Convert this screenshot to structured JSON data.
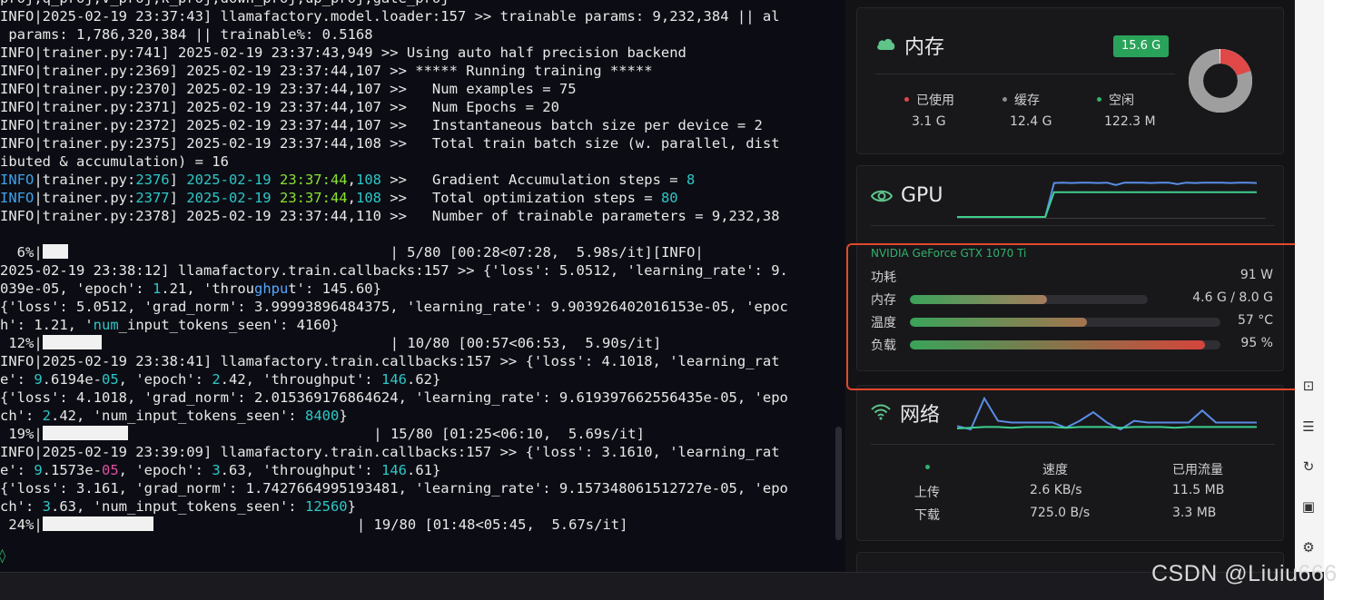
{
  "terminal": {
    "lines": [
      [
        {
          "t": "proj,q_proj,v_proj,k_proj,down_proj,up_proj,gate_proj"
        }
      ],
      [
        {
          "t": "INFO|2025-02-19 23:37:43] llamafactory.model.loader:157 >> trainable params: 9,232,384 || al"
        }
      ],
      [
        {
          "t": " params: 1,786,320,384 || trainable%: 0.5168"
        }
      ],
      [
        {
          "t": "INFO|trainer.py:741] 2025-02-19 23:37:43,949 >> Using auto half precision backend"
        }
      ],
      [
        {
          "t": "INFO|trainer.py:2369] 2025-02-19 23:37:44,107 >> ***** Running training *****"
        }
      ],
      [
        {
          "t": "INFO|trainer.py:2370] 2025-02-19 23:37:44,107 >>   Num examples = 75"
        }
      ],
      [
        {
          "t": "INFO|trainer.py:2371] 2025-02-19 23:37:44,107 >>   Num Epochs = 20"
        }
      ],
      [
        {
          "t": "INFO|trainer.py:2372] 2025-02-19 23:37:44,107 >>   Instantaneous batch size per device = 2"
        }
      ],
      [
        {
          "t": "INFO|trainer.py:2375] 2025-02-19 23:37:44,108 >>   Total train batch size (w. parallel, dist"
        }
      ],
      [
        {
          "t": "ibuted & accumulation) = 16"
        }
      ],
      [
        {
          "t": "INFO",
          "c": "cyan"
        },
        {
          "t": "|trainer.py:"
        },
        {
          "t": "2376",
          "c": "teal"
        },
        {
          "t": "] "
        },
        {
          "t": "2025-02-19",
          "c": "teal"
        },
        {
          "t": " "
        },
        {
          "t": "23:37:44",
          "c": "green"
        },
        {
          "t": ","
        },
        {
          "t": "108",
          "c": "teal"
        },
        {
          "t": " >>   Gradient Accumulation steps = "
        },
        {
          "t": "8",
          "c": "teal"
        }
      ],
      [
        {
          "t": "INFO",
          "c": "cyan"
        },
        {
          "t": "|trainer.py:"
        },
        {
          "t": "2377",
          "c": "teal"
        },
        {
          "t": "] "
        },
        {
          "t": "2025-02-19",
          "c": "teal"
        },
        {
          "t": " "
        },
        {
          "t": "23:37:44",
          "c": "green"
        },
        {
          "t": ","
        },
        {
          "t": "108",
          "c": "teal"
        },
        {
          "t": " >>   Total optimization steps = "
        },
        {
          "t": "80",
          "c": "teal"
        }
      ],
      [
        {
          "t": "INFO|trainer.py:2378] 2025-02-19 23:37:44,110 >>   Number of trainable parameters = 9,232,38"
        }
      ],
      [
        {
          "t": ""
        }
      ],
      [
        {
          "t": "  6%|"
        },
        {
          "bar": 3
        },
        {
          "t": "                                      | 5/80 [00:28<07:28,  5.98s/it][INFO|"
        }
      ],
      [
        {
          "t": "2025-02-19 23:38:12] llamafactory.train.callbacks:157 >> {'loss': 5.0512, 'learning_rate': 9."
        }
      ],
      [
        {
          "t": "039e-05, 'epoch': "
        },
        {
          "t": "1",
          "c": "teal"
        },
        {
          "t": ".21, 'throu"
        },
        {
          "t": "ghpu",
          "c": "blue"
        },
        {
          "t": "t': 145.60}"
        }
      ],
      [
        {
          "t": "{'loss': 5.0512, 'grad_norm': 3.99993896484375, 'learning_rate': 9.903926402016153e-05, 'epoc"
        }
      ],
      [
        {
          "t": "h': 1.21, '"
        },
        {
          "t": "num",
          "c": "teal"
        },
        {
          "t": "_input_tokens_seen': 4160}"
        }
      ],
      [
        {
          "t": " 12%|"
        },
        {
          "bar": 7
        },
        {
          "t": "                                  | 10/80 [00:57<06:53,  5.90s/it]"
        }
      ],
      [
        {
          "t": "INFO|2025-02-19 23:38:41] llamafactory.train.callbacks:157 >> {'loss': 4.1018, 'learning_rat"
        }
      ],
      [
        {
          "t": "e': "
        },
        {
          "t": "9",
          "c": "teal"
        },
        {
          "t": ".6194e-"
        },
        {
          "t": "05",
          "c": "teal"
        },
        {
          "t": ", 'epoch': "
        },
        {
          "t": "2",
          "c": "teal"
        },
        {
          "t": ".42, 'throughput': "
        },
        {
          "t": "146",
          "c": "teal"
        },
        {
          "t": ".62}"
        }
      ],
      [
        {
          "t": "{'loss': 4.1018, 'grad_norm': 2.015369176864624, 'learning_rate': 9.619397662556435e-05, 'epo"
        }
      ],
      [
        {
          "t": "ch': "
        },
        {
          "t": "2",
          "c": "teal"
        },
        {
          "t": ".42, 'num_input_tokens_seen': "
        },
        {
          "t": "8400",
          "c": "teal"
        },
        {
          "t": "}"
        }
      ],
      [
        {
          "t": " 19%|"
        },
        {
          "bar": 10
        },
        {
          "t": "                             | 15/80 [01:25<06:10,  5.69s/it]"
        }
      ],
      [
        {
          "t": "INFO|2025-02-19 23:39:09] llamafactory.train.callbacks:157 >> {'loss': 3.1610, 'learning_rat"
        }
      ],
      [
        {
          "t": "e': "
        },
        {
          "t": "9",
          "c": "teal"
        },
        {
          "t": ".1573e-"
        },
        {
          "t": "05",
          "c": "pink"
        },
        {
          "t": ", 'epoch': "
        },
        {
          "t": "3",
          "c": "teal"
        },
        {
          "t": ".63, 'throughput': "
        },
        {
          "t": "146",
          "c": "teal"
        },
        {
          "t": ".61}"
        }
      ],
      [
        {
          "t": "{'loss': 3.161, 'grad_norm': 1.7427664995193481, 'learning_rate': 9.157348061512727e-05, 'epo"
        }
      ],
      [
        {
          "t": "ch': "
        },
        {
          "t": "3",
          "c": "teal"
        },
        {
          "t": ".63, 'num_input_tokens_seen': "
        },
        {
          "t": "12560",
          "c": "teal"
        },
        {
          "t": "}"
        }
      ],
      [
        {
          "t": " 24%|"
        },
        {
          "bar": 13
        },
        {
          "t": "                        | 19/80 [01:48<05:45,  5.67s/it]"
        }
      ]
    ],
    "prompt_glyph": "◊"
  },
  "memory": {
    "title": "内存",
    "badge": "15.6 G",
    "badge_color": "#2aa35a",
    "legend": [
      {
        "label": "已使用",
        "value": "3.1 G",
        "color": "#e04848"
      },
      {
        "label": "缓存",
        "value": "12.4 G",
        "color": "#8c8c8c"
      },
      {
        "label": "空闲",
        "value": "122.3 M",
        "color": "#2fb36a"
      }
    ],
    "donut": {
      "used_fraction": 0.199,
      "cache_fraction": 0.795,
      "colors": [
        "#e04848",
        "#9e9e9e",
        "#ffffff"
      ]
    }
  },
  "gpu": {
    "title": "GPU",
    "model": "NVIDIA GeForce GTX 1070 Ti",
    "model_color": "#2fb36a",
    "graph": {
      "blue": [
        0.0,
        0.0,
        0.0,
        0.0,
        0.0,
        0.0,
        0.0,
        0.0,
        0.0,
        0.0,
        0.0,
        0.85,
        0.86,
        0.85,
        0.86,
        0.86,
        0.85,
        0.86,
        0.8,
        0.86,
        0.86,
        0.86,
        0.85,
        0.86,
        0.86,
        0.82,
        0.86,
        0.85,
        0.86,
        0.86,
        0.86,
        0.85,
        0.86,
        0.86,
        0.85
      ],
      "green": [
        0.0,
        0.0,
        0.0,
        0.0,
        0.0,
        0.0,
        0.0,
        0.0,
        0.0,
        0.0,
        0.0,
        0.62,
        0.62,
        0.62,
        0.62,
        0.62,
        0.62,
        0.62,
        0.62,
        0.62,
        0.62,
        0.62,
        0.62,
        0.62,
        0.62,
        0.62,
        0.62,
        0.62,
        0.62,
        0.62,
        0.62,
        0.62,
        0.62,
        0.62,
        0.62
      ]
    },
    "rows": [
      {
        "label": "功耗",
        "value": "91 W"
      },
      {
        "label": "内存",
        "value": "4.6 G / 8.0 G",
        "fill": 0.575
      },
      {
        "label": "温度",
        "value": "57 °C",
        "fill": 0.57
      },
      {
        "label": "负载",
        "value": "95 %",
        "fill": 0.95
      }
    ]
  },
  "network": {
    "title": "网络",
    "graph": {
      "blue": [
        0.15,
        0.05,
        0.95,
        0.3,
        0.25,
        0.25,
        0.25,
        0.25,
        0.1,
        0.3,
        0.55,
        0.25,
        0.05,
        0.3,
        0.25,
        0.25,
        0.25,
        0.25,
        0.6,
        0.25,
        0.25,
        0.25,
        0.25
      ],
      "green": [
        0.08,
        0.1,
        0.12,
        0.12,
        0.1,
        0.12,
        0.12,
        0.12,
        0.1,
        0.12,
        0.12,
        0.12,
        0.1,
        0.12,
        0.12,
        0.12,
        0.1,
        0.12,
        0.12,
        0.12,
        0.12,
        0.12,
        0.12
      ]
    },
    "header": {
      "speed": "速度",
      "traffic": "已用流量"
    },
    "rows": [
      {
        "label": "上传",
        "speed": "2.6 KB/s",
        "traffic": "11.5 MB"
      },
      {
        "label": "下载",
        "speed": "725.0 B/s",
        "traffic": "3.3 MB"
      }
    ]
  },
  "side_icons": [
    "terminal-icon",
    "list-icon",
    "refresh-icon",
    "save-icon",
    "gear-icon"
  ],
  "watermark": "CSDN @Liuiu666"
}
